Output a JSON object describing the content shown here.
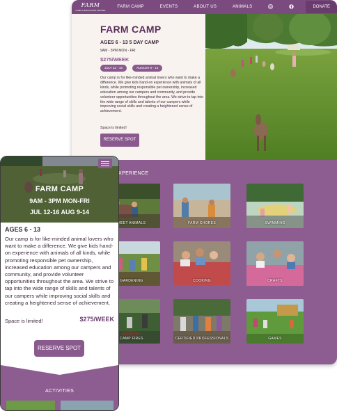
{
  "desktop": {
    "logo": {
      "name": "FARM",
      "tagline": "CAMP & EDUCATION CENTER"
    },
    "nav": {
      "items": [
        "FARM CAMP",
        "EVENTS",
        "ABOUT US",
        "ANIMALS"
      ],
      "donate_label": "DONATE",
      "icons": [
        "instagram-icon",
        "facebook-icon"
      ]
    },
    "hero": {
      "title": "FARM CAMP",
      "ages_line": "AGES 6 - 13    5 DAY CAMP",
      "times_line": "9AM - 3PM    MON - FRI",
      "price": "$275/WEEK",
      "dates": [
        "JULY 12 - 16",
        "AUGUST 9 - 14"
      ],
      "body": "Our camp is for like-minded animal lovers who want to make a difference. We give kids hand-on experience with animals of all kinds, while promoting responsible pet ownership, increased education among our campers and community, and provide volunteer opportunities throughout the area. We strive to tap into the wide range of skills and talents of our campers while improving social skills and creating a heightened sense of achievement.",
      "limited": "Space is limited!",
      "button_label": "RESERVE SPOT"
    },
    "experience": {
      "title": "L EXPERIENCE",
      "tiles": [
        "MEET ANIMALS",
        "FARM CHORES",
        "SWIMMING",
        "GARDENING",
        "COOKING",
        "CRAFTS",
        "CAMP FIRES",
        "CERTIFIED PROFESSIONALS",
        "GAMES"
      ]
    }
  },
  "mobile": {
    "hero": {
      "title": "FARM CAMP",
      "row1": "9AM - 3PM    MON-FRI",
      "row2": "JUL 12-16    AUG 9-14"
    },
    "ages": "AGES 6 - 13",
    "body": "Our camp is for like-minded animal lovers who want to make a difference. We give kids hand-on experience with animals of all kinds, while promoting responsible pet ownership, increased education among our campers and community, and provide volunteer opportunities throughout the area. We strive to tap into the wide range of skills and talents of our campers while improving social skills and creating a heightened sense of achievement.",
    "limited": "Space is limited!",
    "price": "$275/WEEK",
    "button_label": "RESERVE SPOT",
    "activities_title": "ACTIVITIES"
  },
  "colors": {
    "purple": "#8a5a8e",
    "dark_purple": "#5a2f5e",
    "cream": "#f8f3ee"
  }
}
